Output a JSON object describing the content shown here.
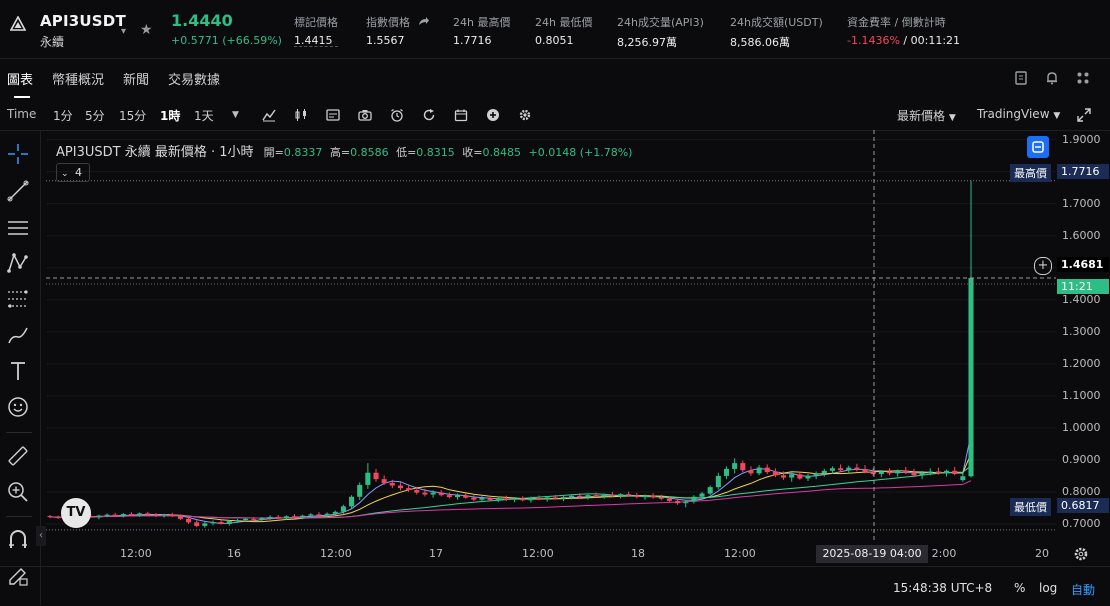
{
  "header": {
    "symbol": "API3USDT",
    "subtitle": "永續",
    "last_price": "1.4440",
    "change": "+0.5771 (+66.59%)",
    "stats": [
      {
        "label": "標記價格",
        "value": "1.4415"
      },
      {
        "label": "指數價格",
        "value": "1.5567"
      },
      {
        "label": "24h 最高價",
        "value": "1.7716"
      },
      {
        "label": "24h 最低價",
        "value": "0.8051"
      },
      {
        "label": "24h成交量(API3)",
        "value": "8,256.97萬"
      },
      {
        "label": "24h成交額(USDT)",
        "value": "8,586.06萬"
      }
    ],
    "funding_label": "資金費率 / 倒數計時",
    "funding_rate": "-1.1436%",
    "funding_sep": " / ",
    "funding_countdown": "00:11:21"
  },
  "tabs": [
    "圖表",
    "幣種概況",
    "新聞",
    "交易數據"
  ],
  "toolbar": {
    "time_label": "Time",
    "intervals": [
      "1分",
      "5分",
      "15分",
      "1時",
      "1天"
    ],
    "active_interval": "1時",
    "price_type": "最新價格",
    "provider": "TradingView"
  },
  "legend": {
    "title": "API3USDT 永續 最新價格 · 1小時",
    "open_label": "開=",
    "open": "0.8337",
    "high_label": "高=",
    "high": "0.8586",
    "low_label": "低=",
    "low": "0.8315",
    "close_label": "收=",
    "close": "0.8485",
    "change": "+0.0148 (+1.78%)",
    "indicator_count": "4"
  },
  "price_axis": {
    "ticks": [
      "1.9000",
      "1.8000",
      "1.7000",
      "1.6000",
      "1.5000",
      "1.4000",
      "1.3000",
      "1.2000",
      "1.1000",
      "1.0000",
      "0.9000",
      "0.8000",
      "0.7000"
    ],
    "high_label": "最高價",
    "high_value": "1.7716",
    "low_label": "最低價",
    "low_value": "0.6817",
    "cursor_price": "1.4681",
    "countdown": "11:21"
  },
  "time_axis": {
    "ticks": [
      "12:00",
      "16",
      "12:00",
      "17",
      "12:00",
      "18",
      "12:00",
      "2:00",
      "20"
    ],
    "crosshair_label": "2025-08-19   04:00"
  },
  "bottom": {
    "clock": "15:48:38 UTC+8",
    "percent": "%",
    "log": "log",
    "auto": "自動"
  },
  "colors": {
    "up": "#2ebd85",
    "down": "#f6465d",
    "accent": "#1e6ef5"
  },
  "chart_data": {
    "type": "candlestick",
    "title": "API3USDT 永續 最新價格 · 1小時",
    "ylim": [
      0.65,
      1.93
    ],
    "x_ticks": [
      "12:00",
      "16",
      "12:00",
      "17",
      "12:00",
      "18",
      "12:00",
      "2:00",
      "20"
    ],
    "y_ticks": [
      0.7,
      0.8,
      0.9,
      1.0,
      1.1,
      1.2,
      1.3,
      1.4,
      1.5,
      1.6,
      1.7,
      1.8,
      1.9
    ],
    "highest": 1.7716,
    "lowest": 0.6817,
    "current": 1.4681,
    "candles": [
      [
        0.725,
        0.728,
        0.718,
        0.722
      ],
      [
        0.722,
        0.726,
        0.716,
        0.72
      ],
      [
        0.72,
        0.727,
        0.715,
        0.724
      ],
      [
        0.724,
        0.73,
        0.718,
        0.721
      ],
      [
        0.721,
        0.728,
        0.716,
        0.725
      ],
      [
        0.725,
        0.731,
        0.719,
        0.722
      ],
      [
        0.722,
        0.729,
        0.715,
        0.726
      ],
      [
        0.726,
        0.733,
        0.721,
        0.729
      ],
      [
        0.729,
        0.735,
        0.722,
        0.725
      ],
      [
        0.725,
        0.734,
        0.72,
        0.731
      ],
      [
        0.731,
        0.737,
        0.724,
        0.728
      ],
      [
        0.728,
        0.736,
        0.722,
        0.733
      ],
      [
        0.733,
        0.738,
        0.726,
        0.729
      ],
      [
        0.729,
        0.734,
        0.722,
        0.727
      ],
      [
        0.727,
        0.732,
        0.72,
        0.73
      ],
      [
        0.73,
        0.735,
        0.722,
        0.724
      ],
      [
        0.724,
        0.73,
        0.712,
        0.716
      ],
      [
        0.716,
        0.722,
        0.7,
        0.705
      ],
      [
        0.705,
        0.712,
        0.69,
        0.694
      ],
      [
        0.694,
        0.706,
        0.688,
        0.702
      ],
      [
        0.702,
        0.711,
        0.696,
        0.706
      ],
      [
        0.706,
        0.712,
        0.698,
        0.7
      ],
      [
        0.7,
        0.712,
        0.695,
        0.709
      ],
      [
        0.709,
        0.716,
        0.703,
        0.712
      ],
      [
        0.712,
        0.719,
        0.706,
        0.716
      ],
      [
        0.716,
        0.722,
        0.709,
        0.713
      ],
      [
        0.713,
        0.722,
        0.708,
        0.719
      ],
      [
        0.719,
        0.727,
        0.713,
        0.722
      ],
      [
        0.722,
        0.728,
        0.715,
        0.718
      ],
      [
        0.718,
        0.727,
        0.713,
        0.724
      ],
      [
        0.724,
        0.731,
        0.718,
        0.721
      ],
      [
        0.721,
        0.729,
        0.715,
        0.726
      ],
      [
        0.726,
        0.734,
        0.72,
        0.73
      ],
      [
        0.73,
        0.737,
        0.724,
        0.727
      ],
      [
        0.727,
        0.736,
        0.722,
        0.732
      ],
      [
        0.732,
        0.742,
        0.726,
        0.738
      ],
      [
        0.738,
        0.76,
        0.732,
        0.755
      ],
      [
        0.755,
        0.79,
        0.748,
        0.785
      ],
      [
        0.785,
        0.83,
        0.775,
        0.822
      ],
      [
        0.822,
        0.89,
        0.81,
        0.86
      ],
      [
        0.86,
        0.872,
        0.832,
        0.84
      ],
      [
        0.84,
        0.852,
        0.822,
        0.828
      ],
      [
        0.828,
        0.838,
        0.812,
        0.82
      ],
      [
        0.82,
        0.83,
        0.805,
        0.812
      ],
      [
        0.812,
        0.824,
        0.8,
        0.806
      ],
      [
        0.806,
        0.816,
        0.792,
        0.798
      ],
      [
        0.798,
        0.81,
        0.786,
        0.792
      ],
      [
        0.792,
        0.805,
        0.782,
        0.798
      ],
      [
        0.798,
        0.806,
        0.786,
        0.79
      ],
      [
        0.79,
        0.799,
        0.78,
        0.784
      ],
      [
        0.784,
        0.795,
        0.776,
        0.789
      ],
      [
        0.789,
        0.796,
        0.779,
        0.782
      ],
      [
        0.782,
        0.79,
        0.772,
        0.776
      ],
      [
        0.776,
        0.787,
        0.768,
        0.781
      ],
      [
        0.781,
        0.789,
        0.772,
        0.775
      ],
      [
        0.775,
        0.786,
        0.768,
        0.78
      ],
      [
        0.78,
        0.788,
        0.772,
        0.776
      ],
      [
        0.776,
        0.784,
        0.768,
        0.779
      ],
      [
        0.779,
        0.787,
        0.771,
        0.774
      ],
      [
        0.774,
        0.785,
        0.767,
        0.781
      ],
      [
        0.781,
        0.789,
        0.774,
        0.778
      ],
      [
        0.778,
        0.786,
        0.77,
        0.783
      ],
      [
        0.783,
        0.791,
        0.776,
        0.779
      ],
      [
        0.779,
        0.787,
        0.771,
        0.784
      ],
      [
        0.784,
        0.793,
        0.777,
        0.788
      ],
      [
        0.788,
        0.796,
        0.78,
        0.784
      ],
      [
        0.784,
        0.793,
        0.776,
        0.79
      ],
      [
        0.79,
        0.798,
        0.782,
        0.786
      ],
      [
        0.786,
        0.795,
        0.779,
        0.791
      ],
      [
        0.791,
        0.8,
        0.784,
        0.787
      ],
      [
        0.787,
        0.796,
        0.78,
        0.793
      ],
      [
        0.793,
        0.801,
        0.785,
        0.789
      ],
      [
        0.789,
        0.797,
        0.78,
        0.784
      ],
      [
        0.784,
        0.792,
        0.776,
        0.788
      ],
      [
        0.788,
        0.796,
        0.779,
        0.783
      ],
      [
        0.783,
        0.791,
        0.774,
        0.779
      ],
      [
        0.779,
        0.786,
        0.768,
        0.772
      ],
      [
        0.772,
        0.78,
        0.76,
        0.765
      ],
      [
        0.765,
        0.775,
        0.752,
        0.77
      ],
      [
        0.77,
        0.79,
        0.764,
        0.785
      ],
      [
        0.785,
        0.8,
        0.778,
        0.795
      ],
      [
        0.795,
        0.82,
        0.79,
        0.815
      ],
      [
        0.815,
        0.86,
        0.808,
        0.85
      ],
      [
        0.85,
        0.88,
        0.84,
        0.872
      ],
      [
        0.872,
        0.905,
        0.858,
        0.89
      ],
      [
        0.89,
        0.898,
        0.862,
        0.868
      ],
      [
        0.868,
        0.88,
        0.85,
        0.858
      ],
      [
        0.858,
        0.884,
        0.852,
        0.876
      ],
      [
        0.876,
        0.886,
        0.856,
        0.862
      ],
      [
        0.862,
        0.874,
        0.846,
        0.852
      ],
      [
        0.852,
        0.864,
        0.838,
        0.845
      ],
      [
        0.845,
        0.86,
        0.832,
        0.855
      ],
      [
        0.855,
        0.864,
        0.838,
        0.842
      ],
      [
        0.842,
        0.856,
        0.834,
        0.85
      ],
      [
        0.85,
        0.864,
        0.84,
        0.858
      ],
      [
        0.858,
        0.872,
        0.848,
        0.866
      ],
      [
        0.866,
        0.88,
        0.856,
        0.874
      ],
      [
        0.874,
        0.886,
        0.862,
        0.868
      ],
      [
        0.868,
        0.882,
        0.858,
        0.876
      ],
      [
        0.876,
        0.888,
        0.864,
        0.87
      ],
      [
        0.87,
        0.884,
        0.858,
        0.862
      ],
      [
        0.862,
        0.874,
        0.85,
        0.856
      ],
      [
        0.856,
        0.868,
        0.846,
        0.864
      ],
      [
        0.864,
        0.874,
        0.852,
        0.858
      ],
      [
        0.858,
        0.87,
        0.848,
        0.866
      ],
      [
        0.866,
        0.878,
        0.856,
        0.86
      ],
      [
        0.86,
        0.872,
        0.846,
        0.852
      ],
      [
        0.852,
        0.866,
        0.84,
        0.86
      ],
      [
        0.86,
        0.874,
        0.852,
        0.864
      ],
      [
        0.864,
        0.876,
        0.854,
        0.858
      ],
      [
        0.858,
        0.87,
        0.848,
        0.866
      ],
      [
        0.866,
        0.878,
        0.852,
        0.856
      ],
      [
        0.837,
        0.859,
        0.832,
        0.849
      ],
      [
        0.849,
        1.772,
        0.845,
        1.468
      ]
    ]
  }
}
